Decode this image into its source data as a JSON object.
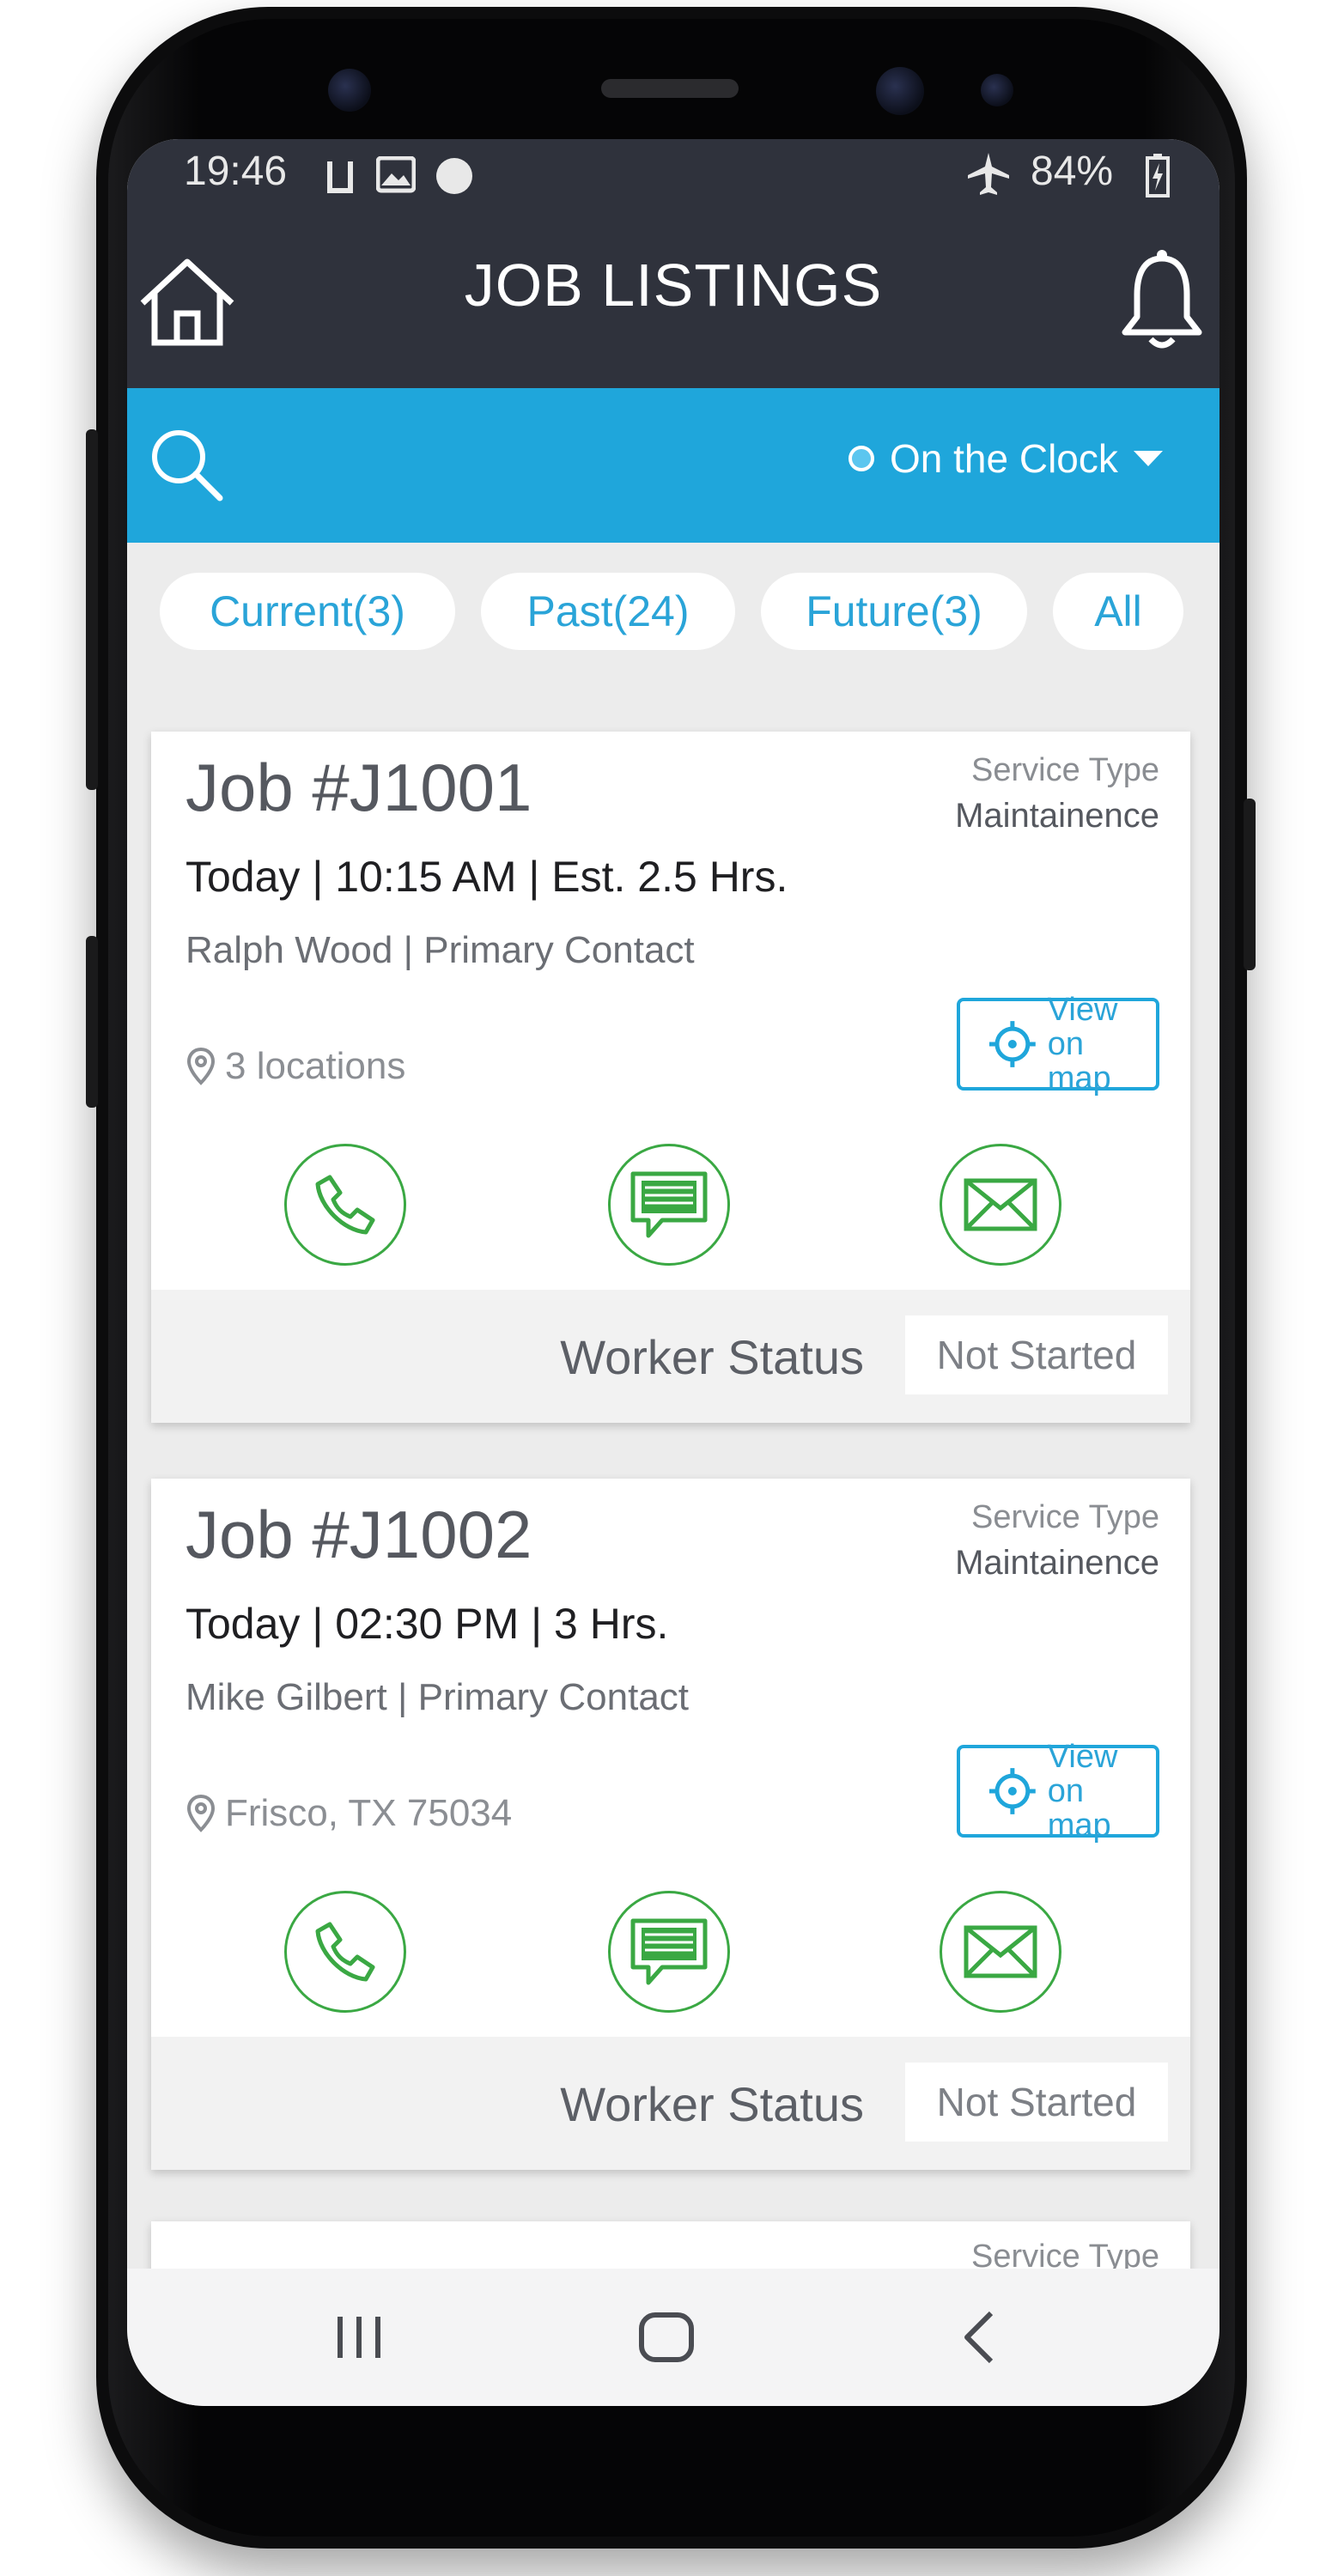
{
  "status_bar": {
    "time": "19:46",
    "battery": "84%"
  },
  "header": {
    "title": "JOB LISTINGS"
  },
  "search": {
    "status_label": "On the Clock"
  },
  "filters": [
    {
      "label": "Current(3)"
    },
    {
      "label": "Past(24)"
    },
    {
      "label": "Future(3)"
    },
    {
      "label": "All"
    }
  ],
  "jobs": [
    {
      "title": "Job #J1001",
      "service_type_label": "Service Type",
      "service_type": "Maintainence",
      "day": "Today",
      "time": "10:15 AM",
      "estimate": "Est. 2.5 Hrs.",
      "contact_name": "Ralph Wood",
      "contact_role": "Primary Contact",
      "location": "3 locations",
      "map_line1": "View",
      "map_line2": "on map",
      "worker_status_label": "Worker Status",
      "worker_status": "Not Started"
    },
    {
      "title": "Job #J1002",
      "service_type_label": "Service Type",
      "service_type": "Maintainence",
      "day": "Today",
      "time": "02:30 PM",
      "estimate": "3 Hrs.",
      "contact_name": "Mike Gilbert",
      "contact_role": "Primary Contact",
      "location": "Frisco, TX 75034",
      "map_line1": "View",
      "map_line2": "on map",
      "worker_status_label": "Worker Status",
      "worker_status": "Not Started"
    },
    {
      "service_type_label": "Service Type"
    }
  ],
  "colors": {
    "header_bg": "#2f323c",
    "accent_blue": "#1fa6db",
    "action_green": "#3aa843",
    "screen_bg": "#ececec"
  },
  "icons": {
    "home": "home-icon",
    "bell": "bell-icon",
    "search": "search-icon",
    "phone": "phone-icon",
    "message": "message-icon",
    "mail": "mail-icon",
    "map_target": "crosshair-icon",
    "location_pin": "location-pin-icon"
  }
}
